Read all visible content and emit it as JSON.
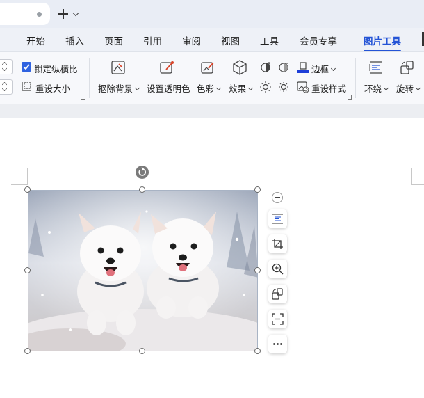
{
  "menu": {
    "items": [
      "开始",
      "插入",
      "页面",
      "引用",
      "审阅",
      "视图",
      "工具",
      "会员专享"
    ],
    "active": "图片工具"
  },
  "ribbon": {
    "lock_aspect_label": "锁定纵横比",
    "lock_aspect_checked": true,
    "reset_size_label": "重设大小",
    "remove_bg_label": "抠除背景",
    "set_transparent_label": "设置透明色",
    "color_label": "色彩",
    "effects_label": "效果",
    "border_label": "边框",
    "reset_style_label": "重设样式",
    "wrap_label": "环绕",
    "rotate_label": "旋转"
  },
  "colors": {
    "accent": "#2454d6",
    "checkbox": "#2f62e0",
    "border_swatch": "#1d3ed8"
  },
  "floating_toolbar": {
    "icons": [
      "zoom-out-icon",
      "wrap-text-icon",
      "crop-icon",
      "zoom-in-icon",
      "rotate-icon",
      "scan-icon",
      "more-icon"
    ]
  },
  "image": {
    "subject": "two white puppies running in snow"
  }
}
